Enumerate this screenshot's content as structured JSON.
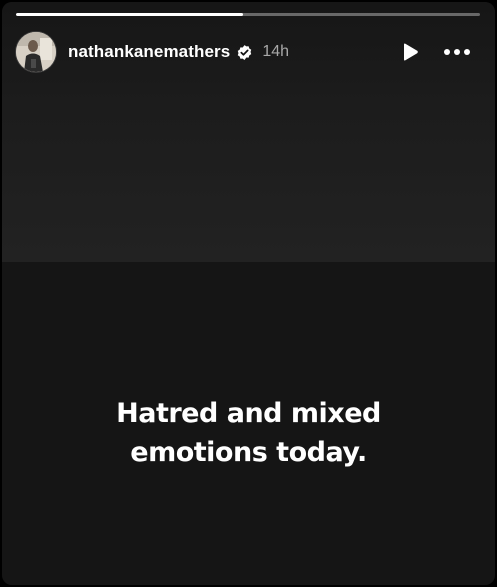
{
  "story": {
    "progress": 0.49,
    "author": {
      "username": "nathankanemathers",
      "verified": true,
      "avatar_icon": "profile-photo"
    },
    "timestamp": "14h",
    "controls": {
      "play_icon": "play-icon",
      "more_icon": "more-options-icon"
    },
    "caption_lines": [
      "Hatred and mixed",
      "emotions today."
    ]
  },
  "colors": {
    "background": "#141414",
    "text": "#ffffff",
    "muted_text": "#a8a8a8",
    "progress_fill": "#ffffff",
    "progress_track": "rgba(255,255,255,0.35)"
  }
}
